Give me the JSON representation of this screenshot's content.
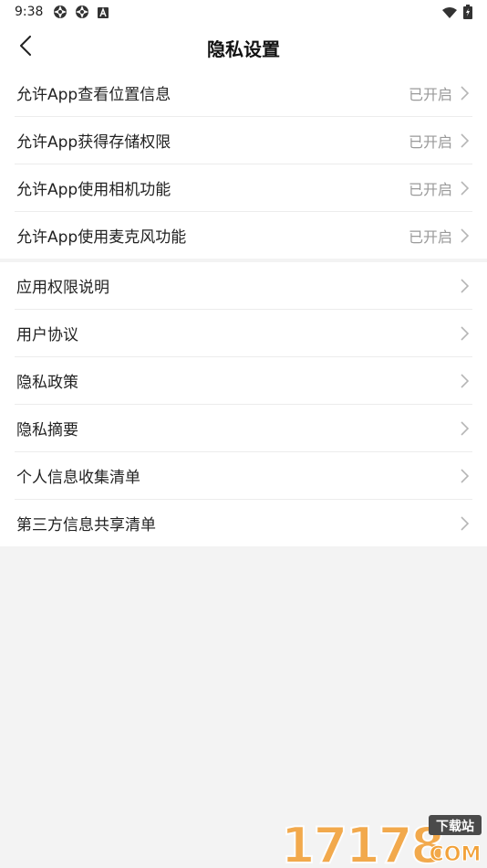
{
  "status_bar": {
    "time": "9:38",
    "notification_icons": [
      "aperture-icon",
      "aperture-icon",
      "app-a-icon"
    ],
    "system_icons": [
      "wifi-icon",
      "battery-charging-icon"
    ]
  },
  "header": {
    "title": "隐私设置",
    "back_icon": "back-chevron-icon"
  },
  "permissions": [
    {
      "label": "允许App查看位置信息",
      "status": "已开启"
    },
    {
      "label": "允许App获得存储权限",
      "status": "已开启"
    },
    {
      "label": "允许App使用相机功能",
      "status": "已开启"
    },
    {
      "label": "允许App使用麦克风功能",
      "status": "已开启"
    }
  ],
  "documents": [
    {
      "label": "应用权限说明"
    },
    {
      "label": "用户协议"
    },
    {
      "label": "隐私政策"
    },
    {
      "label": "隐私摘要"
    },
    {
      "label": "个人信息收集清单"
    },
    {
      "label": "第三方信息共享清单"
    }
  ],
  "watermark": {
    "number": "17178",
    "tag": "下载站",
    "domain": "COM"
  },
  "colors": {
    "background": "#f3f3f3",
    "card": "#ffffff",
    "status_text": "#9a9a9a",
    "divider": "#ececec",
    "watermark_orange": "#f2a23a"
  }
}
